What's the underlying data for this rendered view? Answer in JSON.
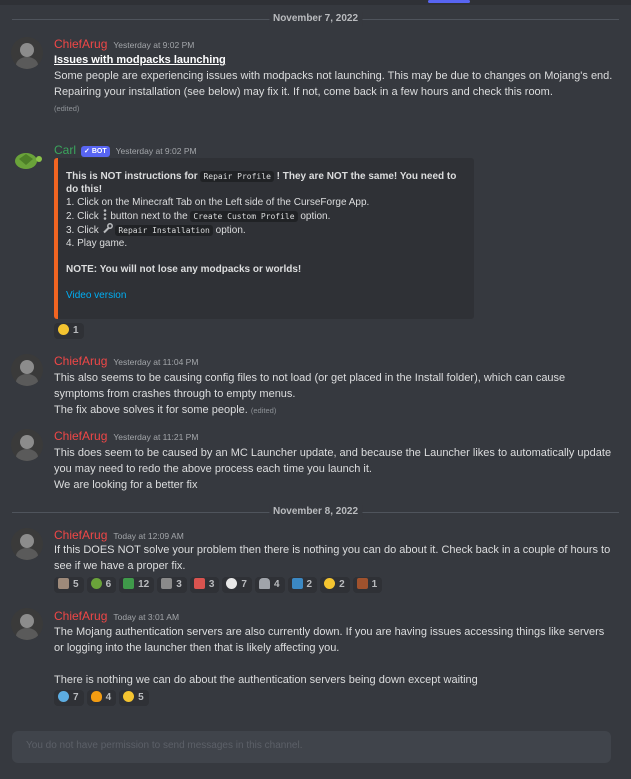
{
  "dates": {
    "first": "November 7, 2022",
    "second": "November 8, 2022"
  },
  "messages": [
    {
      "author": "ChiefArug",
      "timestamp": "Yesterday at 9:02 PM",
      "title": "Issues with modpacks launching",
      "line1": "Some people are experiencing issues with modpacks not launching. This may be due to changes on Mojang's end.",
      "line2": "Repairing your installation (see below) may fix it. If not, come back in a few hours and check this room.",
      "edited": "(edited)"
    },
    {
      "author": "Carl",
      "bot_badge": "✓ BOT",
      "timestamp": "Yesterday at 9:02 PM",
      "embed": {
        "warn_a": "This is NOT instructions for ",
        "warn_code": "Repair Profile",
        "warn_b": " ! They are NOT the same! You need to do this!",
        "step1": "1. Click on the Minecraft Tab on the Left side of the CurseForge App.",
        "step2_a": "2. Click",
        "step2_b": "button next to the",
        "step2_code": "Create Custom Profile",
        "step2_c": "option.",
        "step3_a": "3. Click",
        "step3_code": "Repair Installation",
        "step3_b": "option.",
        "step4": "4. Play game.",
        "note": "NOTE: You will not lose any modpacks or worlds!",
        "video_link": "Video version"
      },
      "reactions": [
        {
          "icon": "clap-emoji",
          "count": "1"
        }
      ]
    },
    {
      "author": "ChiefArug",
      "timestamp": "Yesterday at 11:04 PM",
      "line1": "This also seems to be causing config files to not load (or get placed in the Install folder), which can cause symptoms from crashes through to empty menus.",
      "line2": "The fix above solves it for some people.",
      "edited": "(edited)"
    },
    {
      "author": "ChiefArug",
      "timestamp": "Yesterday at 11:21 PM",
      "line1": "This does seem to be caused by an MC Launcher update, and because the Launcher likes to automatically update you may need to redo the above process each time you launch it.",
      "line2": "We are looking for a better fix"
    },
    {
      "author": "ChiefArug",
      "timestamp": "Today at 12:09 AM",
      "line1": "If this DOES NOT solve your problem then there is nothing you can do about it. Check back in a couple of hours to see if we have a proper fix.",
      "reactions": [
        {
          "icon": "grave-emoji",
          "count": "5"
        },
        {
          "icon": "turtle-emoji",
          "count": "6"
        },
        {
          "icon": "snake-emoji",
          "count": "12"
        },
        {
          "icon": "rock-emoji",
          "count": "3"
        },
        {
          "icon": "ghast-emoji",
          "count": "3"
        },
        {
          "icon": "skull-emoji",
          "count": "7"
        },
        {
          "icon": "tombstone-emoji",
          "count": "4"
        },
        {
          "icon": "f-emoji",
          "count": "2"
        },
        {
          "icon": "thumbs-down-emoji",
          "count": "2"
        },
        {
          "icon": "guitar-emoji",
          "count": "1"
        }
      ]
    },
    {
      "author": "ChiefArug",
      "timestamp": "Today at 3:01 AM",
      "line1": "The Mojang authentication servers are also currently down. If you are having issues accessing things like servers or logging into the launcher then that is likely affecting you.",
      "line2": "There is nothing we can do about the authentication servers being down except waiting",
      "reactions": [
        {
          "icon": "cold-face-emoji",
          "count": "7"
        },
        {
          "icon": "fire-emoji",
          "count": "4"
        },
        {
          "icon": "scream-emoji",
          "count": "5"
        }
      ]
    }
  ],
  "input": {
    "placeholder": "You do not have permission to send messages in this channel."
  },
  "colors": {
    "username": "#f04747",
    "bot_name": "#3ba55d",
    "embed_border": "#f26522",
    "link": "#00aff4"
  }
}
